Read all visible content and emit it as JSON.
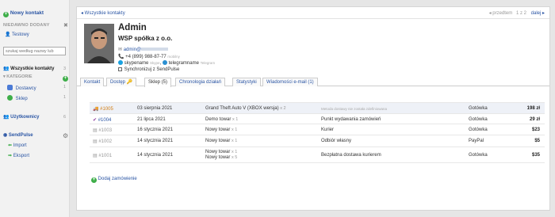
{
  "sidebar": {
    "new_contact": "Nowy kontakt",
    "recent_header": "NIEDAWNO DODANY",
    "recent_close": "✖",
    "recent_item": "Testowy",
    "search_placeholder": "szukaj według nazwy lub",
    "all_contacts": "Wszystkie kontakty",
    "all_contacts_count": "3",
    "categories_header": "KATEGORIE",
    "categories": [
      {
        "label": "Dostawcy",
        "count": "1",
        "color": "#4b7bd6"
      },
      {
        "label": "Sklep",
        "count": "1",
        "color": "#3eae49"
      }
    ],
    "users": "Użytkownicy",
    "users_count": "6",
    "sendpulse": "SendPulse",
    "import": "Import",
    "export": "Eksport"
  },
  "topbar": {
    "back": "◂ Wszystkie kontakty",
    "prev": "◂ przedtem",
    "pages": "1 z 2",
    "next": "dalej ▸"
  },
  "contact": {
    "name": "Admin",
    "company": "WSP spółka z o.o.",
    "email_prefix": "admin@",
    "phone": "+4 (899) 988-87-77",
    "phone_type": "mobilny",
    "skype": "skypename",
    "skype_type": "Skype",
    "telegram": "telegramname",
    "telegram_type": "Telegram",
    "sync": "Synchronizuj z SendPulse"
  },
  "tabs": [
    {
      "label": "Kontakt"
    },
    {
      "label": "Dostęp 🔑"
    },
    {
      "label": "Sklep (5)"
    },
    {
      "label": "Chronologia działań"
    },
    {
      "label": "Statystyki"
    },
    {
      "label": "Wiadomości e-mail (1)"
    }
  ],
  "orders": [
    {
      "icon": "🚚",
      "number": "#1005",
      "date": "03 sierpnia 2021",
      "items": [
        {
          "name": "Grand Theft Auto V (XBOX wersja)",
          "qty": "x 2"
        }
      ],
      "shipping": "Metoda dostawy nie została zdefiniowana",
      "payment": "Gotówka",
      "total": "198 zł"
    },
    {
      "icon": "✔",
      "number": "#1004",
      "date": "21 lipca 2021",
      "items": [
        {
          "name": "Demo towar",
          "qty": "x 1"
        }
      ],
      "shipping": "Punkt wydawania zamówień",
      "payment": "Gotówka",
      "total": "29 zł"
    },
    {
      "icon": "▤",
      "number": "#1003",
      "date": "16 stycznia 2021",
      "items": [
        {
          "name": "Nowy towar",
          "qty": "x 1"
        }
      ],
      "shipping": "Kurier",
      "payment": "Gotówka",
      "total": "$23"
    },
    {
      "icon": "▤",
      "number": "#1002",
      "date": "14 stycznia 2021",
      "items": [
        {
          "name": "Nowy towar",
          "qty": "x 1"
        }
      ],
      "shipping": "Odbiór własny",
      "payment": "PayPal",
      "total": "$5"
    },
    {
      "icon": "▤",
      "number": "#1001",
      "date": "14 stycznia 2021",
      "items": [
        {
          "name": "Nowy towar",
          "qty": "x 1"
        },
        {
          "name": "Nowy towar",
          "qty": "x 5"
        }
      ],
      "shipping": "Bezpłatna dostawa kurierem",
      "payment": "Gotówka",
      "total": "$35"
    }
  ],
  "add_order": "Dodaj zamówienie"
}
